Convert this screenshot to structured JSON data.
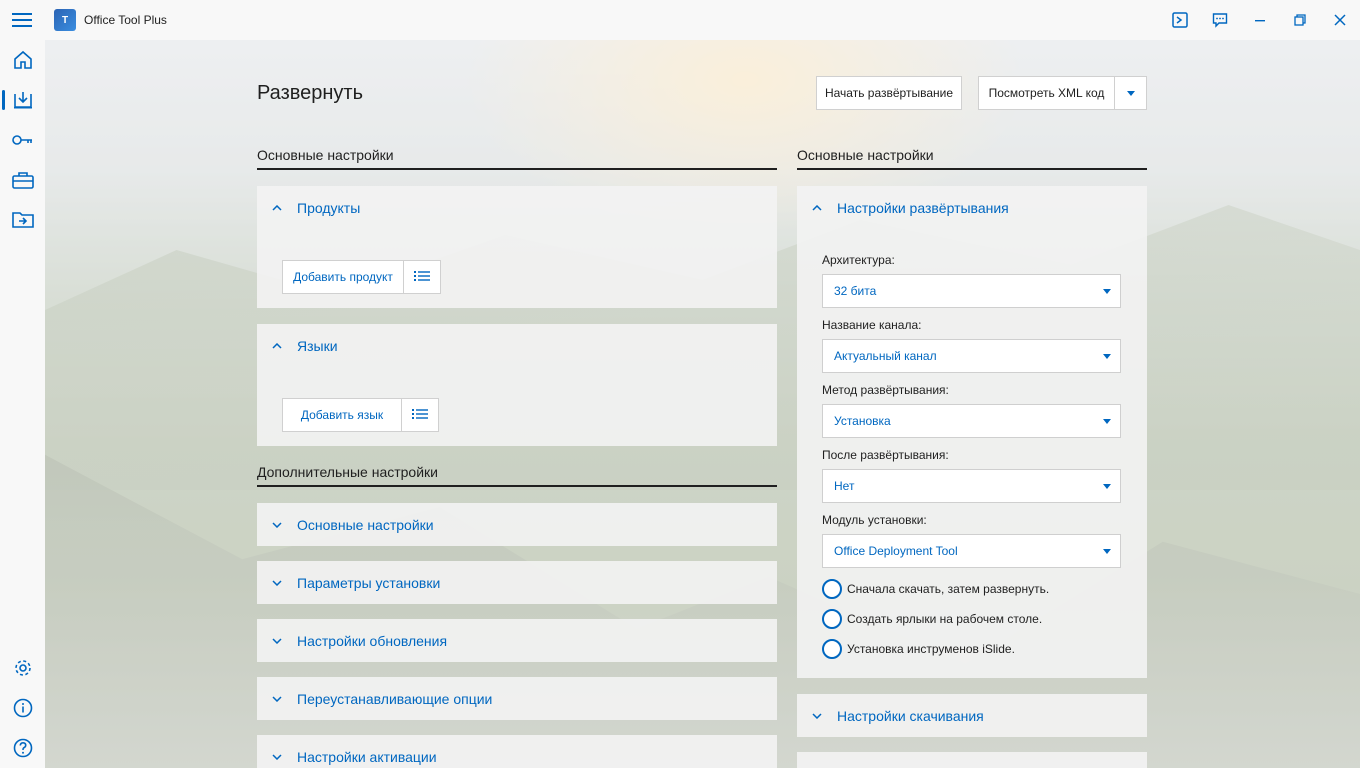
{
  "app": {
    "title": "Office Tool Plus",
    "logo_text": "T"
  },
  "page": {
    "title": "Развернуть"
  },
  "toolbar": {
    "start_deploy": "Начать развёртывание",
    "view_xml": "Посмотреть XML код"
  },
  "left": {
    "basic_header": "Основные настройки",
    "products": {
      "title": "Продукты",
      "add_button": "Добавить продукт"
    },
    "languages": {
      "title": "Языки",
      "add_button": "Добавить язык"
    },
    "advanced_header": "Дополнительные настройки",
    "advanced_items": [
      "Основные настройки",
      "Параметры установки",
      "Настройки обновления",
      "Переустанавливающие опции",
      "Настройки активации"
    ]
  },
  "right": {
    "basic_header": "Основные настройки",
    "deploy_settings": {
      "title": "Настройки развёртывания",
      "fields": [
        {
          "label": "Архитектура:",
          "value": "32 бита"
        },
        {
          "label": "Название канала:",
          "value": "Актуальный канал"
        },
        {
          "label": "Метод развёртывания:",
          "value": "Установка"
        },
        {
          "label": "После развёртывания:",
          "value": "Нет"
        },
        {
          "label": "Модуль установки:",
          "value": "Office Deployment Tool"
        }
      ],
      "options": [
        "Сначала скачать, затем развернуть.",
        "Создать ярлыки на рабочем столе.",
        "Установка инструменов iSlide."
      ]
    },
    "download_settings": {
      "title": "Настройки скачивания"
    }
  },
  "icons": {
    "nav": [
      "home-icon",
      "deploy-icon",
      "key-icon",
      "toolbox-icon",
      "convert-icon"
    ],
    "nav_bottom": [
      "gear-icon",
      "info-icon",
      "help-icon"
    ]
  },
  "colors": {
    "accent": "#0067c0"
  }
}
